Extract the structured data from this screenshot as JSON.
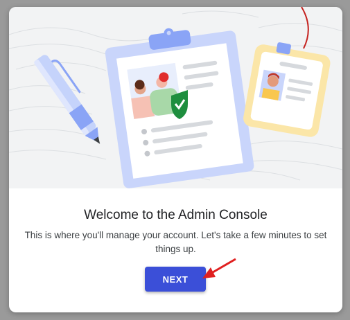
{
  "dialog": {
    "title": "Welcome to the Admin Console",
    "description": "This is where you'll manage your account. Let's take a few minutes to set things up.",
    "next_label": "NEXT"
  },
  "illustration": {
    "items": [
      "pen-icon",
      "clipboard-icon",
      "id-badge-icon",
      "checkmark-shield-icon"
    ]
  },
  "colors": {
    "accent": "#3b4fd8",
    "annotation_arrow": "#e02020",
    "clipboard": "#c9d5fb",
    "badge": "#fbe6a8"
  }
}
